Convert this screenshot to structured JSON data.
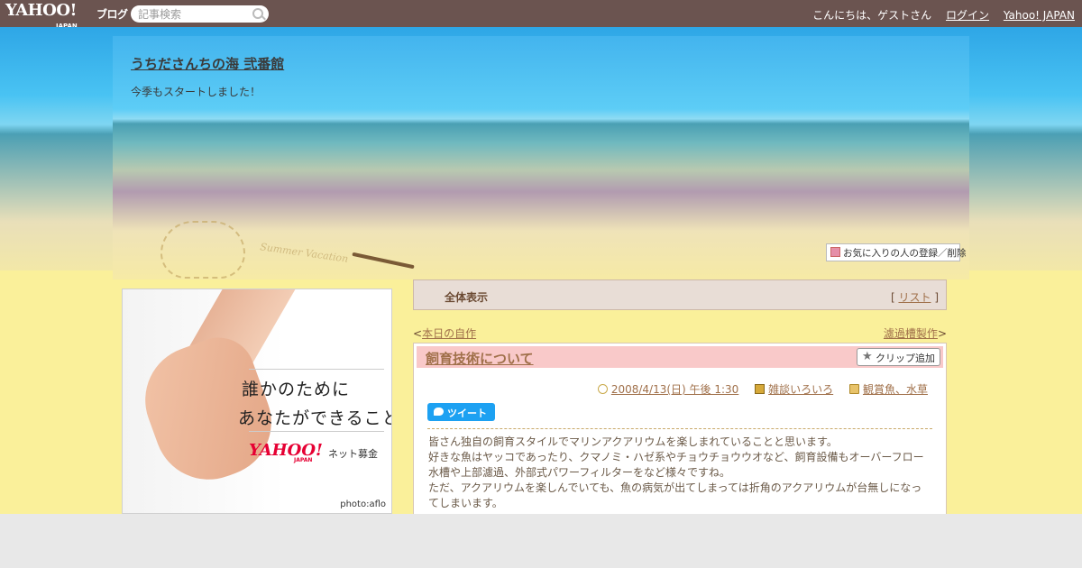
{
  "topbar": {
    "logo_main": "YAHOO!",
    "logo_sub": "JAPAN",
    "logo_blog": "ブログ",
    "search_placeholder": "記事検索",
    "greeting": "こんにちは、ゲストさん",
    "login": "ログイン",
    "yahoo_japan": "Yahoo! JAPAN"
  },
  "header": {
    "title": "うちださんちの海 弐番館",
    "description": "今季もスタートしました！",
    "deco_text": "Summer Vacation",
    "fav_button": "お気に入りの人の登録／削除"
  },
  "ad": {
    "line1": "誰かのために",
    "line2": "あなたができること",
    "logo": "YAHOO!",
    "logo_sub": "JAPAN",
    "label": "ネット募金",
    "credit": "photo:aflo"
  },
  "filter": {
    "title": "全体表示",
    "bracket_open": "[",
    "list_label": "リスト",
    "bracket_close": "]"
  },
  "nav": {
    "prev_arrow": "<",
    "prev_label": "本日の自作",
    "next_label": "濾過槽製作",
    "next_arrow": ">"
  },
  "article": {
    "title": "飼育技術について",
    "clip_button": "クリップ追加",
    "date": "2008/4/13(日) 午後 1:30",
    "category": "雑談いろいろ",
    "folder": "観賞魚、水草",
    "tweet_button": "ツイート",
    "paragraphs": [
      "皆さん独自の飼育スタイルでマリンアクアリウムを楽しまれていることと思います。",
      "好きな魚はヤッコであったり、クマノミ・ハゼ系やチョウチョウウオなど、飼育設備もオーバーフロー",
      "水槽や上部濾過、外部式パワーフィルターをなど様々ですね。",
      "ただ、アクアリウムを楽しんでいても、魚の病気が出てしまっては折角のアクアリウムが台無しになっ",
      "てしまいます。"
    ]
  }
}
